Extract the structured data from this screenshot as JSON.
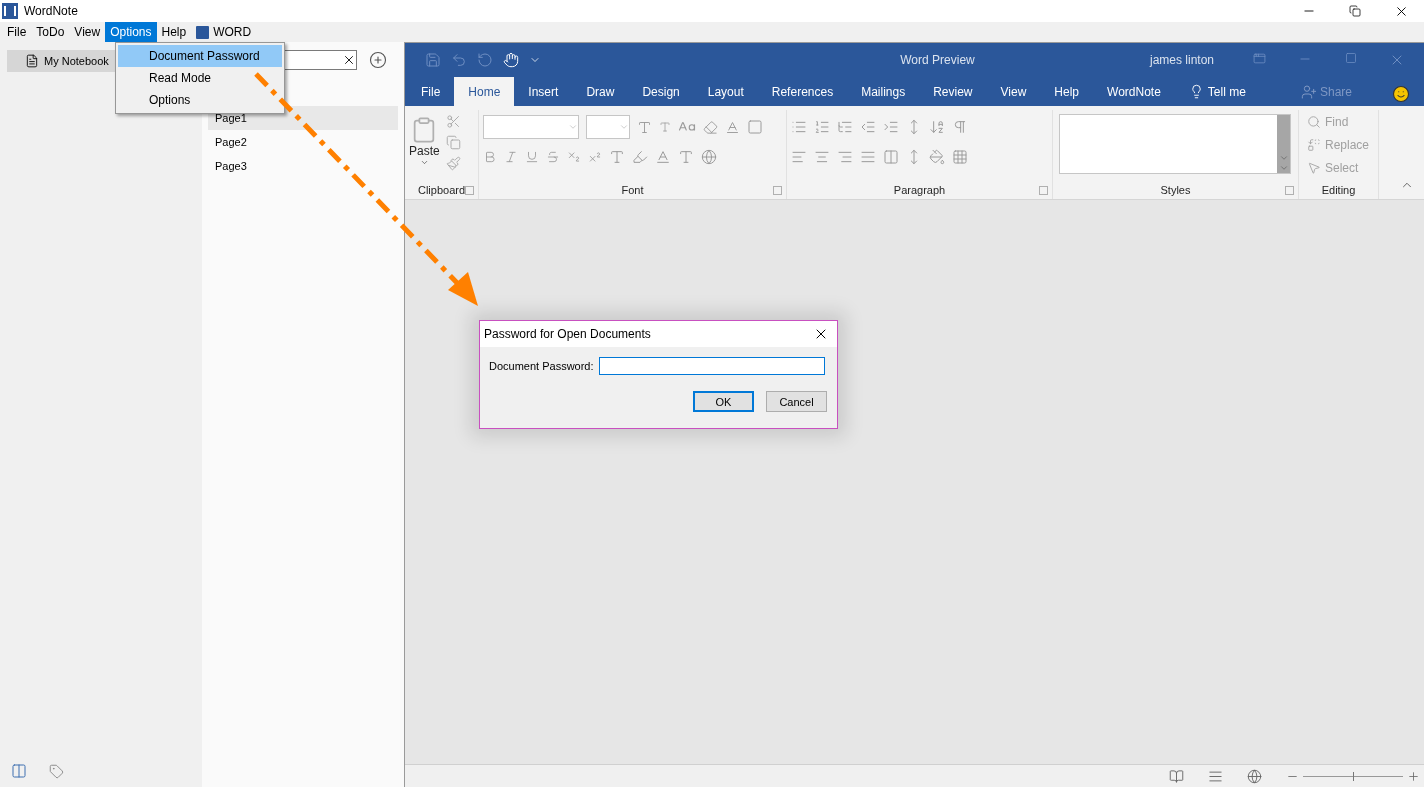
{
  "app": {
    "title": "WordNote"
  },
  "menu_bar": [
    {
      "label": "File",
      "selected": false,
      "kind": "text"
    },
    {
      "label": "ToDo",
      "selected": false,
      "kind": "text"
    },
    {
      "label": "View",
      "selected": false,
      "kind": "text"
    },
    {
      "label": "Options",
      "selected": true,
      "kind": "text"
    },
    {
      "label": "Help",
      "selected": false,
      "kind": "text"
    },
    {
      "label": "WORD",
      "selected": false,
      "kind": "word"
    }
  ],
  "options_menu": [
    {
      "label": "Document Password",
      "selected": true
    },
    {
      "label": "Read Mode",
      "selected": false
    },
    {
      "label": "Options",
      "selected": false
    }
  ],
  "notebooks": [
    {
      "label": "My Notebook",
      "selected": true
    }
  ],
  "pages": [
    {
      "label": "Page1",
      "selected": true
    },
    {
      "label": "Page2",
      "selected": false
    },
    {
      "label": "Page3",
      "selected": false
    }
  ],
  "word": {
    "title": "Word Preview",
    "user": "james linton",
    "tabs": [
      {
        "label": "File",
        "selected": false
      },
      {
        "label": "Home",
        "selected": true
      },
      {
        "label": "Insert",
        "selected": false
      },
      {
        "label": "Draw",
        "selected": false
      },
      {
        "label": "Design",
        "selected": false
      },
      {
        "label": "Layout",
        "selected": false
      },
      {
        "label": "References",
        "selected": false
      },
      {
        "label": "Mailings",
        "selected": false
      },
      {
        "label": "Review",
        "selected": false
      },
      {
        "label": "View",
        "selected": false
      },
      {
        "label": "Help",
        "selected": false
      },
      {
        "label": "WordNote",
        "selected": false
      }
    ],
    "tell_me": "Tell me",
    "share": {
      "label": "Share",
      "disabled": true
    },
    "paste": "Paste",
    "groups": [
      "Clipboard",
      "Font",
      "Paragraph",
      "Styles",
      "Editing"
    ],
    "editing": [
      {
        "label": "Find",
        "disabled": true
      },
      {
        "label": "Replace",
        "disabled": true
      },
      {
        "label": "Select",
        "disabled": true
      }
    ],
    "zoom": {
      "level": 0.5
    }
  },
  "dialog": {
    "title": "Password for Open Documents",
    "field_label": "Document Password:",
    "buttons": [
      {
        "label": "OK",
        "default": true
      },
      {
        "label": "Cancel",
        "default": false
      }
    ]
  }
}
